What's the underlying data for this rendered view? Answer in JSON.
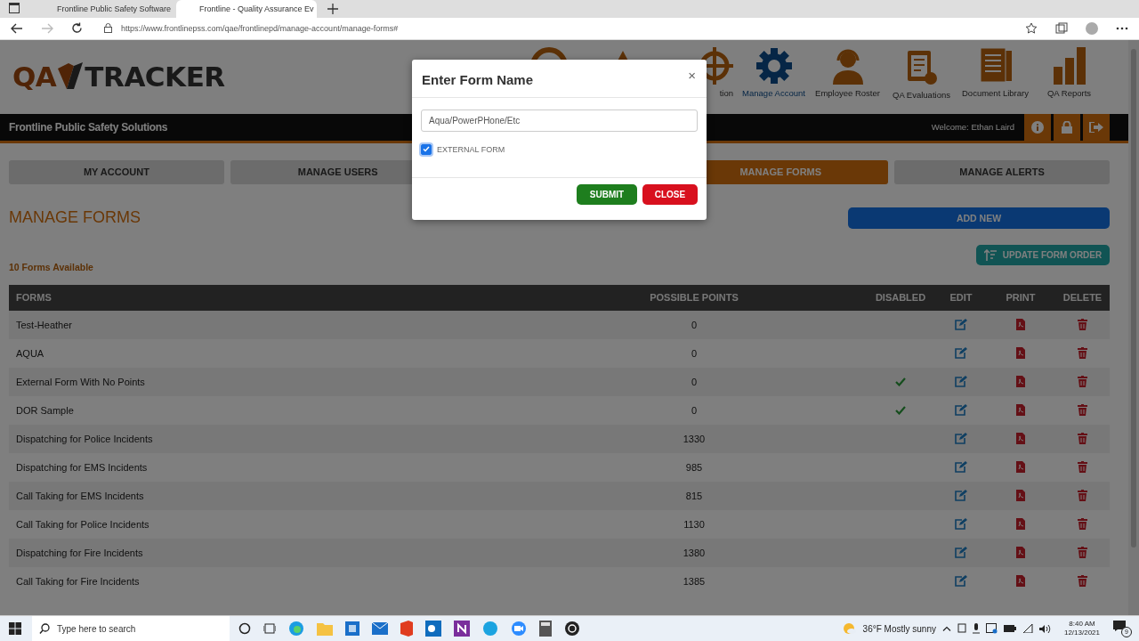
{
  "browser": {
    "tabs": [
      {
        "title": "Frontline Public Safety Software",
        "selected": false
      },
      {
        "title": "Frontline - Quality Assurance Ev",
        "selected": true
      }
    ],
    "url": "https://www.frontlinepss.com/qae/frontlinepd/manage-account/manage-forms#"
  },
  "header": {
    "logo_left": "QA",
    "logo_right": "TRACKER",
    "nav": [
      {
        "selected": false
      },
      {
        "selected": false
      },
      {
        "label": "tion",
        "selected": false
      },
      {
        "label": "Manage Account",
        "selected": true
      },
      {
        "label": "Employee Roster",
        "selected": false
      },
      {
        "label": "QA Evaluations",
        "selected": false
      },
      {
        "label": "Document Library",
        "selected": false
      },
      {
        "label": "QA Reports",
        "selected": false
      }
    ]
  },
  "company_bar": {
    "name": "Frontline Public Safety Solutions",
    "welcome": "Welcome: Ethan Laird"
  },
  "tabs": [
    {
      "label": "MY ACCOUNT",
      "selected": false
    },
    {
      "label": "MANAGE USERS",
      "selected": false
    },
    {
      "label": "MANAGE FORMS",
      "selected": true
    },
    {
      "label": "MANAGE ALERTS",
      "selected": false
    }
  ],
  "page_title": "MANAGE FORMS",
  "add_button": "ADD NEW",
  "order_button": "UPDATE FORM ORDER",
  "count": "10 Forms Available",
  "table": {
    "columns": [
      "FORMS",
      "POSSIBLE POINTS",
      "DISABLED",
      "EDIT",
      "PRINT",
      "DELETE"
    ],
    "rows": [
      {
        "name": "Test-Heather",
        "points": "0",
        "disabled": false
      },
      {
        "name": "AQUA",
        "points": "0",
        "disabled": false
      },
      {
        "name": "External Form With No Points",
        "points": "0",
        "disabled": true
      },
      {
        "name": "DOR Sample",
        "points": "0",
        "disabled": true
      },
      {
        "name": "Dispatching for Police Incidents",
        "points": "1330",
        "disabled": false
      },
      {
        "name": "Dispatching for EMS Incidents",
        "points": "985",
        "disabled": false
      },
      {
        "name": "Call Taking for EMS Incidents",
        "points": "815",
        "disabled": false
      },
      {
        "name": "Call Taking for Police Incidents",
        "points": "1130",
        "disabled": false
      },
      {
        "name": "Dispatching for Fire Incidents",
        "points": "1380",
        "disabled": false
      },
      {
        "name": "Call Taking for Fire Incidents",
        "points": "1385",
        "disabled": false
      }
    ]
  },
  "modal": {
    "title": "Enter Form Name",
    "close": "×",
    "value": "Aqua/PowerPHone/Etc",
    "external_label": "EXTERNAL FORM",
    "external_checked": true,
    "submit": "SUBMIT",
    "cancel": "CLOSE"
  },
  "taskbar": {
    "search_placeholder": "Type here to search",
    "weather": "36°F  Mostly sunny",
    "time": "8:40 AM",
    "date": "12/13/2021",
    "notifications": "9"
  }
}
